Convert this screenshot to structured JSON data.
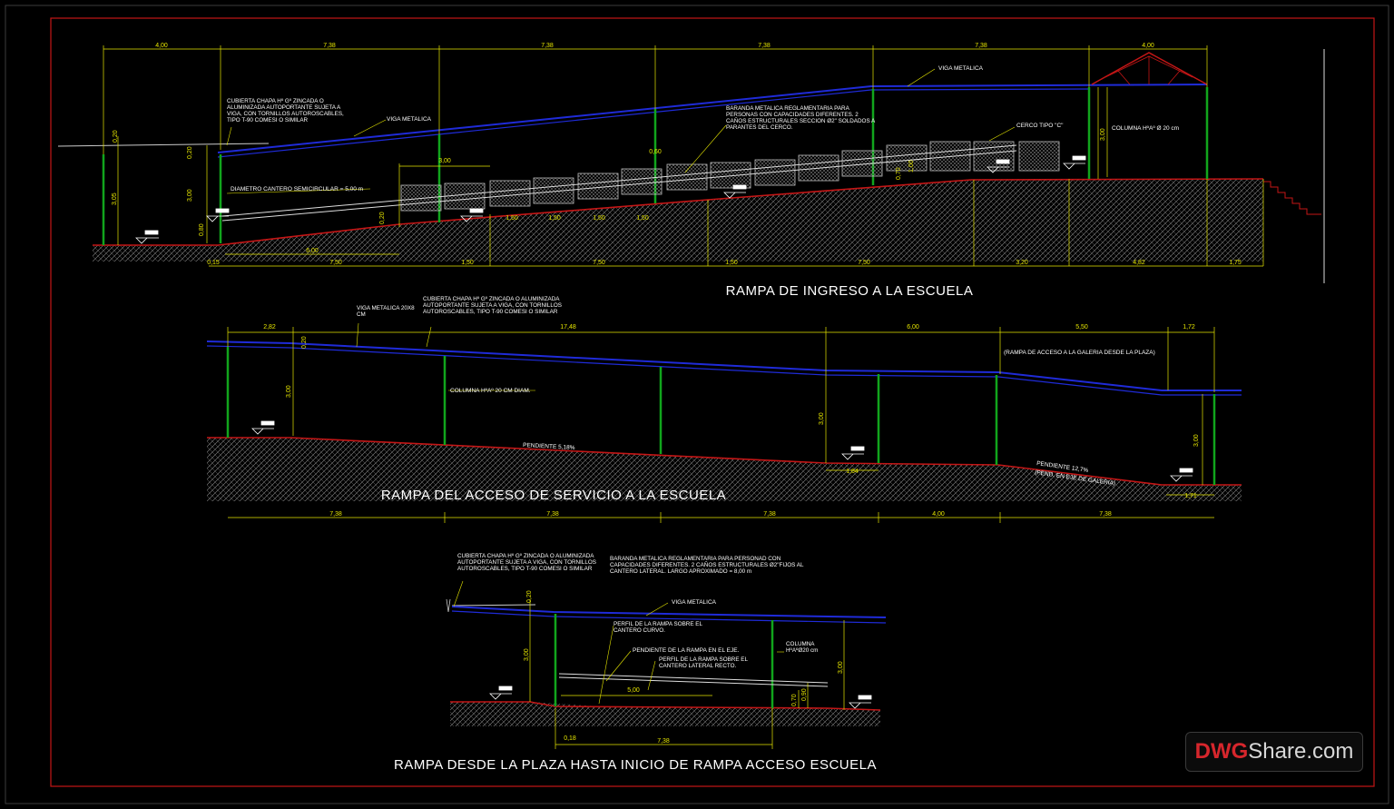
{
  "palette": {
    "background": "#000000",
    "frame": "#d11a1a",
    "dimension": "#e6e600",
    "beam": "#1f2bd8",
    "ground": "#c41616",
    "column": "#11a51c",
    "text": "#ffffff"
  },
  "titles": {
    "section1": "RAMPA DE INGRESO A LA ESCUELA",
    "section2": "RAMPA DEL ACCESO DE SERVICIO A LA ESCUELA",
    "section3": "RAMPA DESDE LA PLAZA HASTA INICIO DE RAMPA ACCESO ESCUELA"
  },
  "section1": {
    "top_dims": [
      "4,00",
      "7,38",
      "7,38",
      "7,38",
      "7,38",
      "4,00"
    ],
    "bottom_dims": [
      "0,15",
      "7,50",
      "1,50",
      "7,50",
      "1,50",
      "7,50",
      "3,20",
      "4,82",
      "1,75"
    ],
    "rail_dims": [
      "1,50",
      "1,50",
      "1,50",
      "1,50"
    ],
    "misc_dims": [
      "0,20",
      "0,20",
      "3,05",
      "3,00",
      "0,80",
      "3,00",
      "0,20",
      "6,00",
      "0,60",
      "0,70",
      "1,00",
      "3,00"
    ],
    "notes": {
      "cubierta": "CUBIERTA CHAPA Hº Gº ZINCADA O ALUMINIZADA AUTOPORTANTE SUJETA A VIGA, CON TORNILLOS AUTOROSCABLES, TIPO T-90 COMESI O SIMILAR",
      "viga1": "VIGA METALICA",
      "viga2": "VIGA METALICA",
      "diametro": "DIAMETRO CANTERO SEMICIRCULAR = 5,00 m",
      "baranda": "BARANDA METALICA REGLAMENTARIA PARA PERSONAS CON CAPACIDADES DIFERENTES. 2 CAÑOS ESTRUCTURALES SECCION Ø2\" SOLDADOS A PARANTES DEL CERCO.",
      "cerco": "CERCO TIPO \"C\"",
      "columna": "COLUMNA HºAº Ø 20 cm"
    }
  },
  "section2": {
    "top_dims": [
      "2,82",
      "17,48",
      "6,00",
      "5,50",
      "1,72"
    ],
    "bottom_dims": [
      "7,38",
      "7,38",
      "7,38",
      "4,00",
      "7,38"
    ],
    "misc_dims": [
      "0,20",
      "3,00",
      "3,00",
      "1,84",
      "3,00",
      "1,71"
    ],
    "notes": {
      "viga": "VIGA METALICA 20X8 CM",
      "cubierta": "CUBIERTA CHAPA Hº Gº ZINCADA O ALUMINIZADA AUTOPORTANTE SUJETA A VIGA, CON TORNILLOS AUTOROSCABLES, TIPO T-90 COMESI O SIMILAR",
      "rampa_galeria": "(RAMPA DE ACCESO A LA GALERIA DESDE LA PLAZA)",
      "columna": "COLUMNA HºAº 20 CM DIAM.",
      "pendiente1": "PENDIENTE 5,18%",
      "pendiente2": "PENDIENTE 12,7%",
      "pend_eje": "(PEND. EN EJE DE GALERIA)"
    }
  },
  "section3": {
    "dims": [
      "0,20",
      "3,00",
      "5,00",
      "0,70",
      "0,90",
      "3,00",
      "0,18",
      "7,38"
    ],
    "notes": {
      "cubierta": "CUBIERTA CHAPA Hº Gº ZINCADA O ALUMINIZADA AUTOPORTANTE SUJETA A VIGA, CON TORNILLOS AUTOROSCABLES, TIPO T-90 COMESI O SIMILAR",
      "baranda": "BARANDA METALICA REGLAMENTARIA PARA PERSONAD CON CAPACIDADES DIFERENTES. 2 CAÑOS ESTRUCTURALES Ø2\"FIJOS AL CANTERO LATERAL. LARGO APROXIMADO = 8,00 m",
      "viga": "VIGA METALICA",
      "perfil_curvo": "PERFIL DE LA RAMPA SOBRE EL CANTERO CURVO.",
      "pendiente": "PENDIENTE DE LA RAMPA EN EL EJE.",
      "perfil_recto": "PERFIL DE LA RAMPA SOBRE EL CANTERO LATERAL RECTO.",
      "columna": "COLUMNA HºAºØ20 cm"
    }
  },
  "watermark": {
    "part1": "DWG",
    "part2": "Share.com"
  }
}
